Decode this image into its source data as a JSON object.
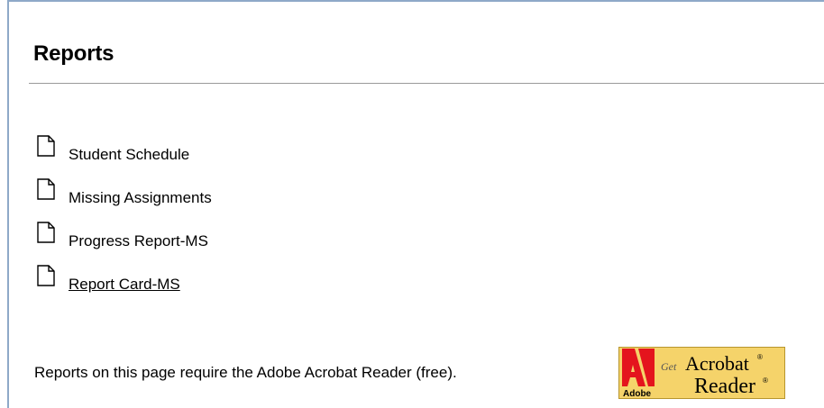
{
  "page": {
    "title": "Reports"
  },
  "reports": [
    {
      "label": "Student Schedule",
      "icon": "document-icon",
      "link": false
    },
    {
      "label": "Missing Assignments",
      "icon": "document-icon",
      "link": false
    },
    {
      "label": "Progress Report-MS",
      "icon": "document-icon",
      "link": false
    },
    {
      "label": "Report Card-MS",
      "icon": "document-icon",
      "link": true
    }
  ],
  "footer": {
    "note": "Reports on this page require the Adobe Acrobat Reader (free).",
    "badge": {
      "icon": "adobe-acrobat-logo",
      "get": "Get",
      "adobe": "Adobe",
      "line1": "Acrobat",
      "line2": "Reader"
    }
  },
  "colors": {
    "frame_border": "#8ea9c8",
    "badge_bg": "#f5d36a",
    "adobe_red": "#e4141d"
  }
}
